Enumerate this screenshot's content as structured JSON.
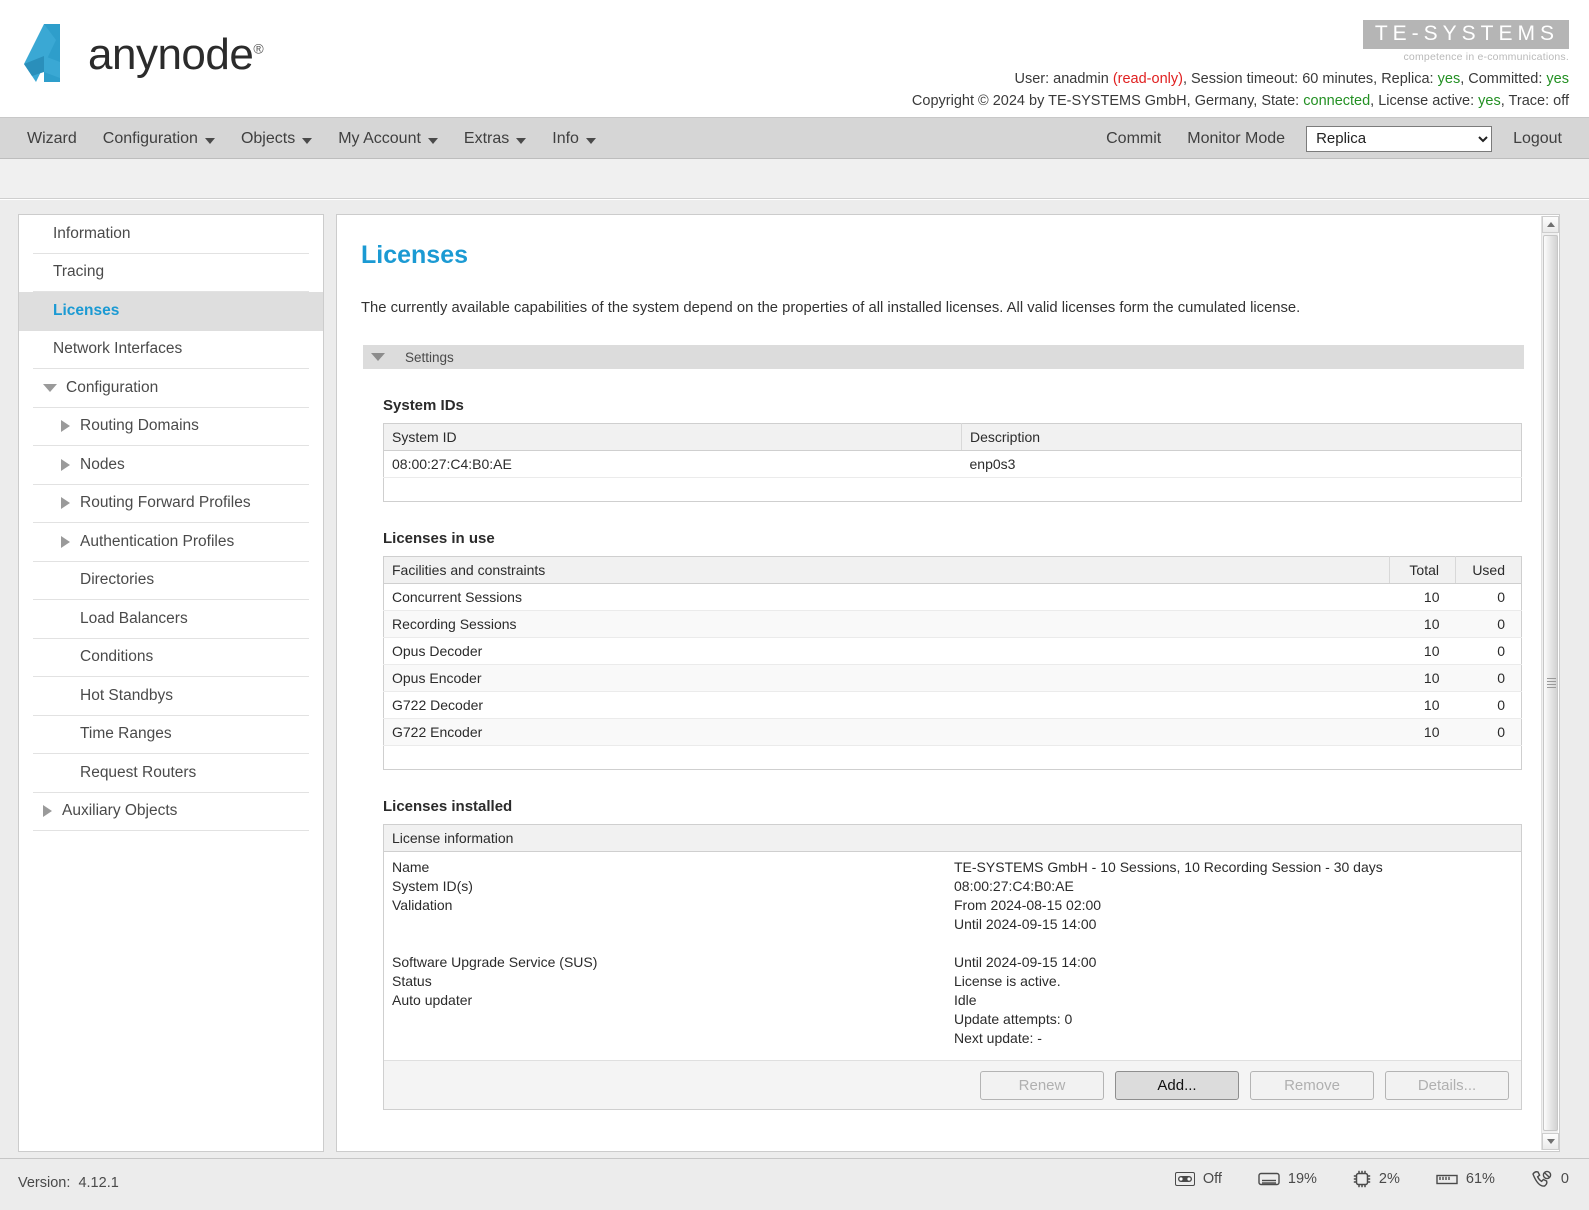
{
  "brand": {
    "product": "anynode",
    "product_reg": "®",
    "company": "TE-SYSTEMS",
    "company_tagline": "competence in e-communications."
  },
  "header": {
    "line1": {
      "user_label": "User:",
      "user_name": "anadmin",
      "user_role": "(read-only)",
      "session": ", Session timeout: 60 minutes, Replica: ",
      "replica_value": "yes",
      "committed_label": ", Committed: ",
      "committed_value": "yes"
    },
    "line2": {
      "copyright": "Copyright © 2024 by TE-SYSTEMS GmbH, Germany, State: ",
      "state_value": "connected",
      "license_label": ", License active: ",
      "license_value": "yes",
      "trace_label": ", Trace: off"
    }
  },
  "nav": {
    "left": [
      {
        "label": "Wizard",
        "has_caret": false
      },
      {
        "label": "Configuration",
        "has_caret": true
      },
      {
        "label": "Objects",
        "has_caret": true
      },
      {
        "label": "My Account",
        "has_caret": true
      },
      {
        "label": "Extras",
        "has_caret": true
      },
      {
        "label": "Info",
        "has_caret": true
      }
    ],
    "right": [
      {
        "label": "Commit"
      },
      {
        "label": "Monitor Mode"
      }
    ],
    "select": {
      "value": "Replica",
      "options": [
        "Replica"
      ]
    },
    "logout": "Logout"
  },
  "sidebar": {
    "items": [
      {
        "label": "Information",
        "level": 0,
        "icon": "none",
        "selected": false
      },
      {
        "label": "Tracing",
        "level": 0,
        "icon": "none",
        "selected": false
      },
      {
        "label": "Licenses",
        "level": 0,
        "icon": "none",
        "selected": true
      },
      {
        "label": "Network Interfaces",
        "level": 0,
        "icon": "none",
        "selected": false
      },
      {
        "label": "Configuration",
        "level": 0,
        "icon": "triangle-down",
        "selected": false
      },
      {
        "label": "Routing Domains",
        "level": 1,
        "icon": "triangle-right",
        "selected": false
      },
      {
        "label": "Nodes",
        "level": 1,
        "icon": "triangle-right",
        "selected": false
      },
      {
        "label": "Routing Forward Profiles",
        "level": 1,
        "icon": "triangle-right",
        "selected": false
      },
      {
        "label": "Authentication Profiles",
        "level": 1,
        "icon": "triangle-right",
        "selected": false
      },
      {
        "label": "Directories",
        "level": 1,
        "icon": "none",
        "selected": false
      },
      {
        "label": "Load Balancers",
        "level": 1,
        "icon": "none",
        "selected": false
      },
      {
        "label": "Conditions",
        "level": 1,
        "icon": "none",
        "selected": false
      },
      {
        "label": "Hot Standbys",
        "level": 1,
        "icon": "none",
        "selected": false
      },
      {
        "label": "Time Ranges",
        "level": 1,
        "icon": "none",
        "selected": false
      },
      {
        "label": "Request Routers",
        "level": 1,
        "icon": "none",
        "selected": false
      },
      {
        "label": "Auxiliary Objects",
        "level": 0,
        "icon": "triangle-right",
        "selected": false
      }
    ]
  },
  "main": {
    "title": "Licenses",
    "description": "The currently available capabilities of the system depend on the properties of all installed licenses. All valid licenses form the cumulated license.",
    "settings_bar_label": "Settings",
    "system_ids": {
      "heading": "System IDs",
      "columns": [
        "System ID",
        "Description"
      ],
      "rows": [
        {
          "system_id": "08:00:27:C4:B0:AE",
          "description": "enp0s3"
        }
      ]
    },
    "licenses_in_use": {
      "heading": "Licenses in use",
      "columns": [
        "Facilities and constraints",
        "Total",
        "Used"
      ],
      "rows": [
        {
          "facility": "Concurrent Sessions",
          "total": "10",
          "used": "0"
        },
        {
          "facility": "Recording Sessions",
          "total": "10",
          "used": "0"
        },
        {
          "facility": "Opus Decoder",
          "total": "10",
          "used": "0"
        },
        {
          "facility": "Opus Encoder",
          "total": "10",
          "used": "0"
        },
        {
          "facility": "G722 Decoder",
          "total": "10",
          "used": "0"
        },
        {
          "facility": "G722 Encoder",
          "total": "10",
          "used": "0"
        }
      ]
    },
    "licenses_installed": {
      "heading": "Licenses installed",
      "column_header": "License information",
      "rows": [
        {
          "key": "Name",
          "value": "TE-SYSTEMS GmbH - 10 Sessions, 10 Recording Session - 30 days"
        },
        {
          "key": "System ID(s)",
          "value": "08:00:27:C4:B0:AE"
        },
        {
          "key": "Validation",
          "value": "From 2024-08-15 02:00"
        },
        {
          "key": "",
          "value": "Until 2024-09-15 14:00"
        },
        {
          "key": "Software Upgrade Service (SUS)",
          "value": "Until 2024-09-15 14:00"
        },
        {
          "key": "Status",
          "value": "License is active."
        },
        {
          "key": "Auto updater",
          "value": "Idle"
        },
        {
          "key": "",
          "value": "Update attempts: 0"
        },
        {
          "key": "",
          "value": "Next update: -"
        }
      ],
      "buttons": [
        {
          "label": "Renew",
          "enabled": false
        },
        {
          "label": "Add...",
          "enabled": true
        },
        {
          "label": "Remove",
          "enabled": false
        },
        {
          "label": "Details...",
          "enabled": false
        }
      ]
    }
  },
  "statusbar": {
    "version_label": "Version:",
    "version_value": "4.12.1",
    "stats": [
      {
        "icon": "recorder-icon",
        "value": "Off"
      },
      {
        "icon": "disk-icon",
        "value": "19%"
      },
      {
        "icon": "cpu-icon",
        "value": "2%"
      },
      {
        "icon": "memory-icon",
        "value": "61%"
      },
      {
        "icon": "calls-icon",
        "value": "0"
      }
    ]
  },
  "colors": {
    "accent": "#1b9ad3",
    "ok": "#239023",
    "warn": "#e02020",
    "navbar": "#d6d6d6"
  }
}
